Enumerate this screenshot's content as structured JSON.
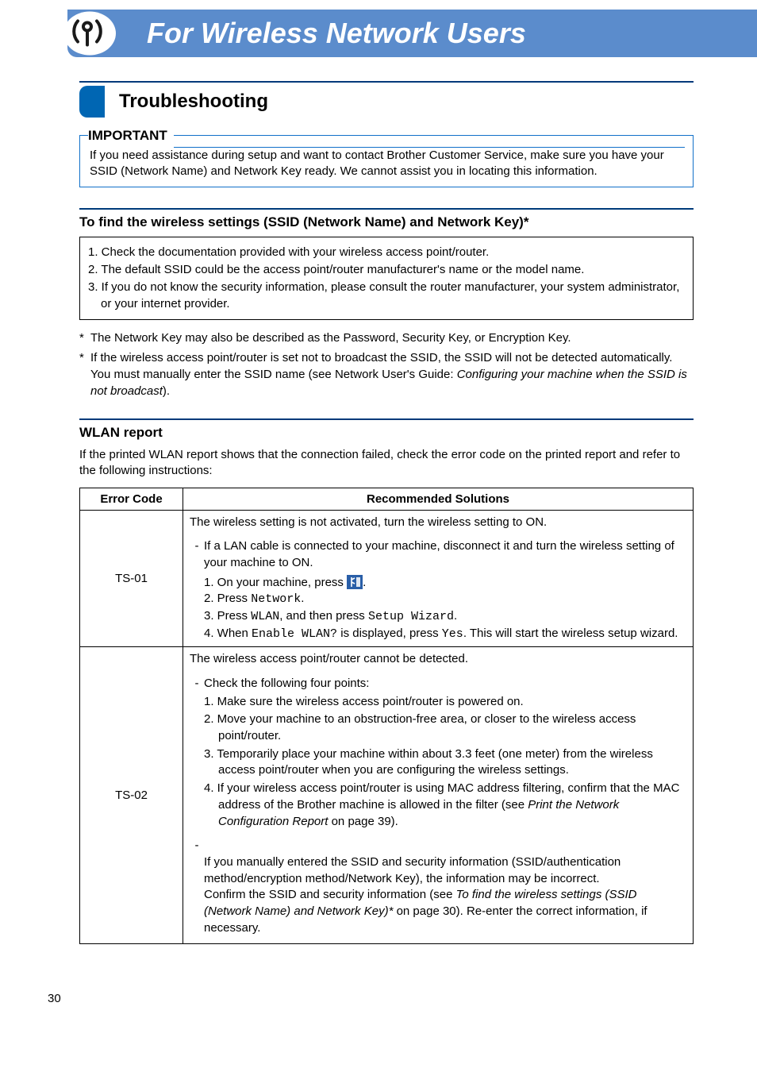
{
  "banner": {
    "title": "For Wireless Network Users"
  },
  "section": {
    "heading": "Troubleshooting"
  },
  "important": {
    "label": "IMPORTANT",
    "text": "If you need assistance during setup and want to contact Brother Customer Service, make sure you have your SSID (Network Name) and Network Key ready. We cannot assist you in locating this information."
  },
  "find_settings": {
    "heading": "To find the wireless settings (SSID (Network Name) and Network Key)*",
    "steps": [
      "1. Check the documentation provided with your wireless access point/router.",
      "2. The default SSID could be the access point/router manufacturer's name or the model name.",
      "3. If you do not know the security information, please consult the router manufacturer, your system administrator, or your internet provider."
    ],
    "footnotes": [
      {
        "plain": "The Network Key may also be described as the Password, Security Key, or Encryption Key."
      },
      {
        "plain_a": "If the wireless access point/router is set not to broadcast the SSID, the SSID will not be detected automatically. You must manually enter the SSID name (see Network User's Guide: ",
        "italic": "Configuring your machine when the SSID is not broadcast",
        "plain_b": ")."
      }
    ]
  },
  "wlan": {
    "heading": "WLAN report",
    "intro": "If the printed WLAN report shows that the connection failed, check the error code on the printed report and refer to the following instructions:",
    "th_code": "Error Code",
    "th_sol": "Recommended Solutions",
    "rows": [
      {
        "code": "TS-01",
        "lead": "The wireless setting is not activated, turn the wireless setting to ON.",
        "dash_lead": "If a LAN cable is connected to your machine, disconnect it and turn the wireless setting of your machine to ON.",
        "steps": {
          "s1a": "1. On your machine, press ",
          "s1b": ".",
          "s2a": "2. Press ",
          "s2m": "Network",
          "s2b": ".",
          "s3a": "3. Press ",
          "s3m1": "WLAN",
          "s3mid": ", and then press ",
          "s3m2": "Setup Wizard",
          "s3b": ".",
          "s4a": "4. When ",
          "s4m1": "Enable WLAN?",
          "s4mid": " is displayed, press ",
          "s4m2": "Yes",
          "s4b": ". This will start the wireless setup wizard."
        }
      },
      {
        "code": "TS-02",
        "lead": "The wireless access point/router cannot be detected.",
        "dash1": "Check the following four points:",
        "nums": [
          "1. Make sure the wireless access point/router is powered on.",
          "2. Move your machine to an obstruction-free area, or closer to the wireless access point/router.",
          "3. Temporarily place your machine within about 3.3 feet (one meter) from the wireless access point/router when you are configuring the wireless settings."
        ],
        "num4": {
          "a": "4. If your wireless access point/router is using MAC address filtering, confirm that the MAC address of the Brother machine is allowed in the filter (see ",
          "i": "Print the Network Configuration Report",
          "b": " on page 39)."
        },
        "dash2": {
          "a": "If you manually entered the SSID and security information (SSID/authentication method/encryption method/Network Key), the information may be incorrect.\nConfirm the SSID and security information (see ",
          "i": "To find the wireless settings (SSID (Network Name) and Network Key)*",
          "b": " on page 30). Re-enter the correct information, if necessary."
        }
      }
    ]
  },
  "page_number": "30"
}
